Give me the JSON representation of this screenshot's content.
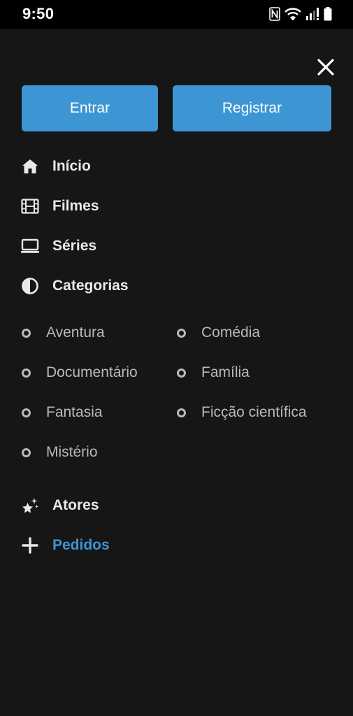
{
  "status_bar": {
    "time": "9:50",
    "icons": [
      "nfc-icon",
      "wifi-icon",
      "signal-icon",
      "battery-icon"
    ]
  },
  "menu": {
    "close_icon": "close-icon",
    "buttons": {
      "login_label": "Entrar",
      "register_label": "Registrar"
    },
    "nav": [
      {
        "label": "Início",
        "icon": "home-icon"
      },
      {
        "label": "Filmes",
        "icon": "film-icon"
      },
      {
        "label": "Séries",
        "icon": "tv-icon"
      },
      {
        "label": "Categorias",
        "icon": "contrast-icon"
      }
    ],
    "categories": [
      "Aventura",
      "Comédia",
      "Documentário",
      "Família",
      "Fantasia",
      "Ficção científica",
      "Mistério"
    ],
    "extra_nav": [
      {
        "label": "Atores",
        "icon": "stars-icon"
      },
      {
        "label": "Pedidos",
        "icon": "plus-icon"
      }
    ]
  },
  "colors": {
    "background": "#161617",
    "accent": "#3d95d3",
    "text_primary": "#e9e9ea",
    "text_secondary": "#b9b9bc"
  }
}
